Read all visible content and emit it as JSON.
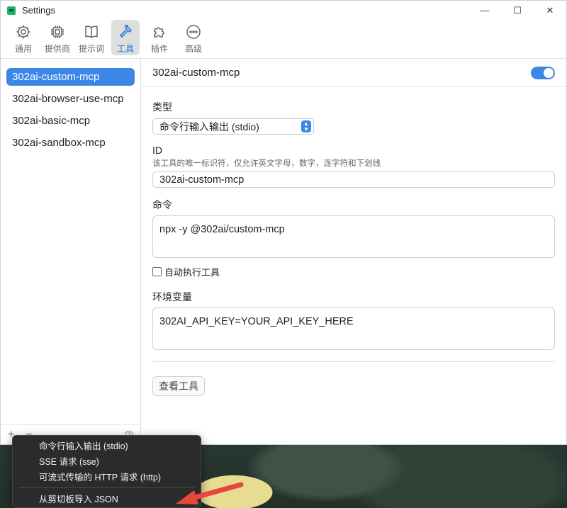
{
  "window": {
    "title": "Settings",
    "controls": {
      "minimize": "—",
      "maximize": "☐",
      "close": "✕"
    }
  },
  "toolbar": {
    "items": [
      {
        "label": "通用",
        "icon": "gear-icon"
      },
      {
        "label": "提供商",
        "icon": "chip-icon"
      },
      {
        "label": "提示词",
        "icon": "book-icon"
      },
      {
        "label": "工具",
        "icon": "hammer-icon",
        "active": true
      },
      {
        "label": "插件",
        "icon": "puzzle-icon"
      },
      {
        "label": "高级",
        "icon": "more-icon"
      }
    ]
  },
  "sidebar": {
    "items": [
      {
        "label": "302ai-custom-mcp",
        "selected": true
      },
      {
        "label": "302ai-browser-use-mcp"
      },
      {
        "label": "302ai-basic-mcp"
      },
      {
        "label": "302ai-sandbox-mcp"
      }
    ],
    "footer": {
      "add": "+",
      "remove": "−",
      "help": "?"
    }
  },
  "main": {
    "header_title": "302ai-custom-mcp",
    "enabled": true,
    "type_label": "类型",
    "type_value": "命令行输入输出 (stdio)",
    "id_label": "ID",
    "id_hint": "该工具的唯一标识符，仅允许英文字母，数字，连字符和下划线",
    "id_value": "302ai-custom-mcp",
    "command_label": "命令",
    "command_value": "npx -y @302ai/custom-mcp",
    "auto_run_label": "自动执行工具",
    "auto_run_checked": false,
    "env_label": "环境变量",
    "env_value": "302AI_API_KEY=YOUR_API_KEY_HERE",
    "view_tools_button": "查看工具"
  },
  "context_menu": {
    "items": [
      "命令行输入输出 (stdio)",
      "SSE 请求 (sse)",
      "可流式传输的 HTTP 请求 (http)"
    ],
    "import_item": "从剪切板导入 JSON"
  },
  "colors": {
    "accent": "#3b86e6",
    "menu_bg": "#2b2b2b",
    "annotation_arrow": "#e8453c"
  }
}
